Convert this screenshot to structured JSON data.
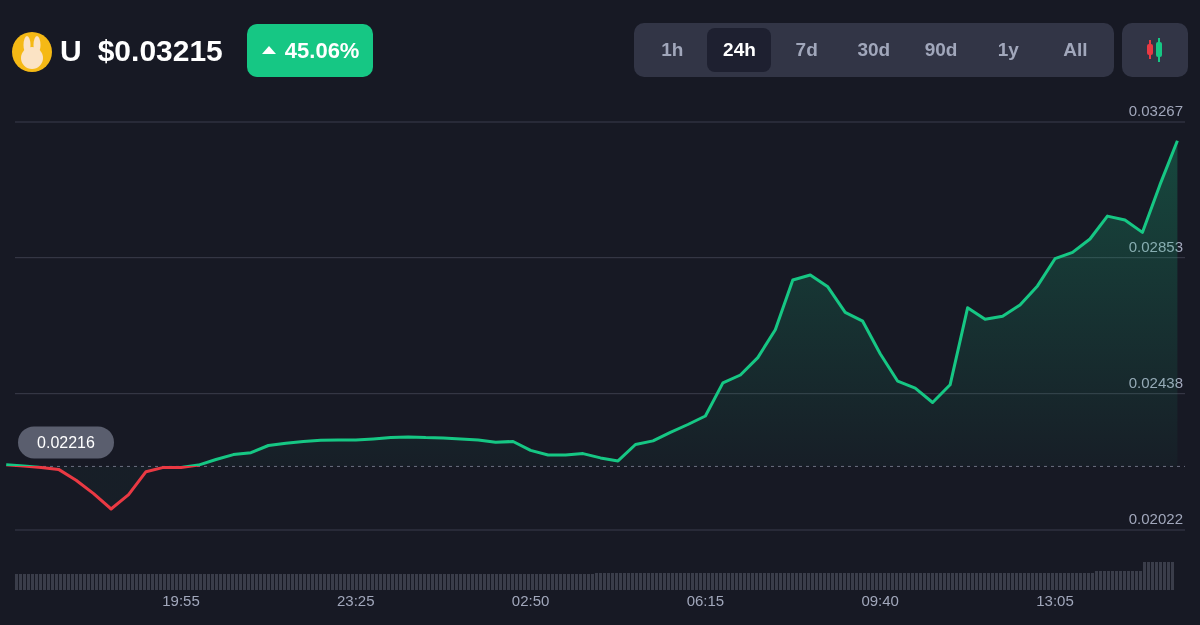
{
  "coin": {
    "symbol": "U",
    "price": "$0.03215"
  },
  "change": {
    "rising": true,
    "text": "45.06%"
  },
  "ranges": [
    {
      "label": "1h",
      "selected": false
    },
    {
      "label": "24h",
      "selected": true
    },
    {
      "label": "7d",
      "selected": false
    },
    {
      "label": "30d",
      "selected": false
    },
    {
      "label": "90d",
      "selected": false
    },
    {
      "label": "1y",
      "selected": false
    },
    {
      "label": "All",
      "selected": false
    }
  ],
  "chart": {
    "chart_data": {
      "type": "area",
      "categories": [
        null,
        null,
        null,
        null,
        null,
        null,
        null,
        null,
        null,
        null,
        "19:55",
        null,
        null,
        null,
        null,
        null,
        null,
        null,
        null,
        null,
        "23:25",
        null,
        null,
        null,
        null,
        null,
        null,
        null,
        null,
        null,
        "02:50",
        null,
        null,
        null,
        null,
        null,
        null,
        null,
        null,
        null,
        "06:15",
        null,
        null,
        null,
        null,
        null,
        null,
        null,
        null,
        null,
        "09:40",
        null,
        null,
        null,
        null,
        null,
        null,
        null,
        null,
        null,
        "13:05",
        null,
        null,
        null,
        null,
        null,
        null,
        null
      ],
      "series": [
        {
          "color": "#16c784",
          "values": [
            0.02221,
            0.02217,
            0.02213,
            0.02207,
            0.02174,
            0.02133,
            0.02086,
            0.0213,
            0.022,
            0.02213,
            0.02213,
            0.0222,
            0.02237,
            0.02252,
            0.02258,
            0.0228,
            0.02287,
            0.02292,
            0.02296,
            0.02297,
            0.02297,
            0.023,
            0.02304,
            0.02306,
            0.02304,
            0.02303,
            0.023,
            0.02297,
            0.0229,
            0.02292,
            0.02265,
            0.02251,
            0.02251,
            0.02255,
            0.02242,
            0.02233,
            0.02283,
            0.02294,
            0.0232,
            0.02344,
            0.0237,
            0.02471,
            0.02495,
            0.02548,
            0.02633,
            0.02785,
            0.028,
            0.02764,
            0.02686,
            0.02659,
            0.0256,
            0.02476,
            0.02455,
            0.02411,
            0.02465,
            0.027,
            0.02665,
            0.02674,
            0.02709,
            0.02767,
            0.0285,
            0.02869,
            0.0291,
            0.0298,
            0.02968,
            0.0293,
            0.03075,
            0.0321
          ]
        }
      ],
      "ylim": [
        0.02022,
        0.03267
      ],
      "yticks": [
        {
          "value": 0.02022,
          "label": "0.02022"
        },
        {
          "value": 0.02438,
          "label": "0.02438"
        },
        {
          "value": 0.02853,
          "label": "0.02853"
        },
        {
          "value": 0.03267,
          "label": "0.03267"
        }
      ],
      "ref_lines": [
        {
          "axis": "y",
          "value": 0.02216,
          "label": "0.02216"
        }
      ]
    }
  }
}
